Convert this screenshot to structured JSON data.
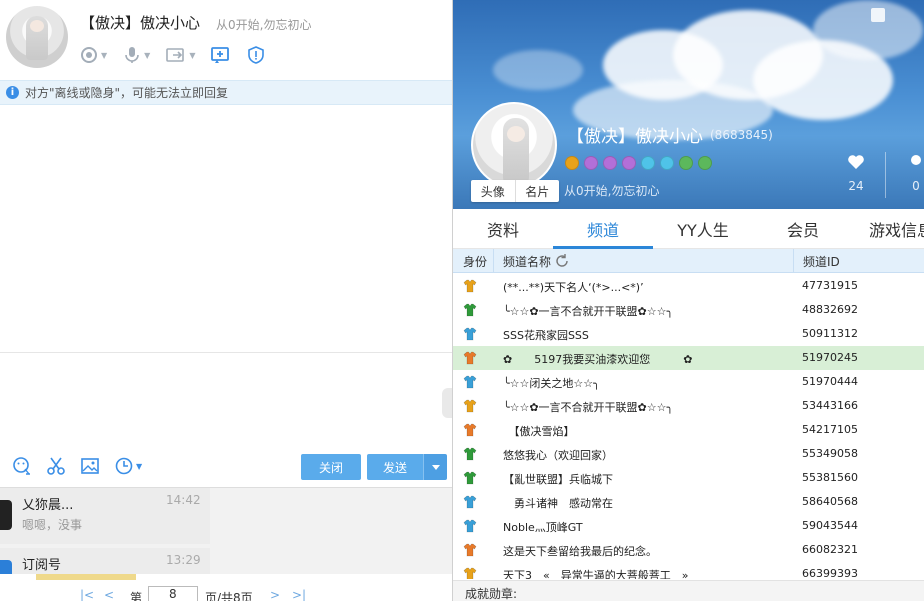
{
  "chat": {
    "contact_name": "【傲决】傲决小心",
    "signature": "从0开始,勿忘初心",
    "notice": "对方\"离线或隐身\"，可能无法立即回复",
    "close_label": "关闭",
    "send_label": "发送"
  },
  "recent": [
    {
      "name": "乂狝晨...",
      "time": "14:42",
      "message": "嗯嗯，没事"
    },
    {
      "name": "订阅号",
      "time": "13:29",
      "message": ""
    }
  ],
  "pager": {
    "prefix": "第",
    "page": "8",
    "suffix": "页/共8页"
  },
  "profile": {
    "name": "【傲决】傲决小心",
    "id": "(8683845)",
    "signature": "从0开始,勿忘初心",
    "avatar_tab": "头像",
    "card_tab": "名片",
    "likes": "24",
    "second_stat": "0"
  },
  "tabs": [
    "资料",
    "频道",
    "YY人生",
    "会员",
    "游戏信息"
  ],
  "active_tab": "频道",
  "table": {
    "headers": {
      "role": "身份",
      "name": "频道名称",
      "id": "频道ID"
    },
    "rows": [
      {
        "name": "(**...**)天下名人‘(*>...<*)’",
        "id": "47731915",
        "color": "#e8a21a"
      },
      {
        "name": "╰☆☆✿一言不合就开干联盟✿☆☆╮",
        "id": "48832692",
        "color": "#2f9a3a"
      },
      {
        "name": "SSS花飛家园SSS",
        "id": "50911312",
        "color": "#39a0d8"
      },
      {
        "name": "✿　　5197我要买油漆欢迎您　　　✿",
        "id": "51970245",
        "color": "#e87a2a",
        "selected": true
      },
      {
        "name": "╰☆☆闭关之地☆☆╮",
        "id": "51970444",
        "color": "#39a0d8"
      },
      {
        "name": "╰☆☆✿一言不合就开干联盟✿☆☆╮",
        "id": "53443166",
        "color": "#e8a21a"
      },
      {
        "name": "　【傲决雪焰】",
        "id": "54217105",
        "color": "#e87a2a"
      },
      {
        "name": "悠悠我心（欢迎回家）",
        "id": "55349058",
        "color": "#2f9a3a"
      },
      {
        "name": "【亂世联盟】兵临城下",
        "id": "55381560",
        "color": "#2f9a3a"
      },
      {
        "name": "　勇斗诸神　感动常在",
        "id": "58640568",
        "color": "#39a0d8"
      },
      {
        "name": "Noble灬顶峰GT",
        "id": "59043544",
        "color": "#39a0d8"
      },
      {
        "name": "这是天下叁留给我最后的纪念。",
        "id": "66082321",
        "color": "#e87a2a"
      },
      {
        "name": "天下3　«　异常牛逼的大菩般菩工　»",
        "id": "66399393",
        "color": "#e8a21a"
      }
    ]
  },
  "footer": "成就勋章:",
  "colors": {
    "accent": "#2b86d8",
    "button": "#5aabeb",
    "selected_row": "#d8efd6"
  },
  "icons": [
    "camera-icon",
    "mic-icon",
    "share-screen-icon",
    "remote-assist-icon",
    "security-shield-icon",
    "emoji-icon",
    "scissors-icon",
    "image-icon",
    "history-icon",
    "refresh-icon",
    "heart-icon",
    "skin-icon"
  ]
}
